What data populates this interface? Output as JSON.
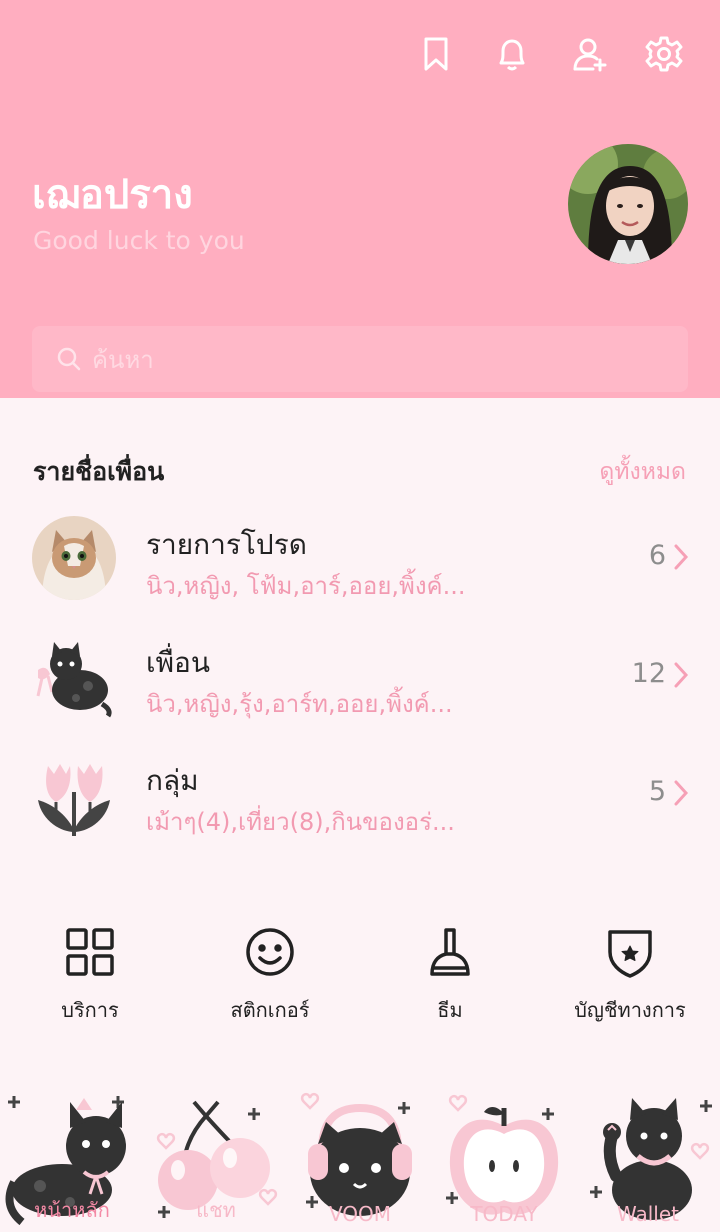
{
  "header": {
    "profile_name": "เฌอปราง",
    "status_message": "Good luck to you",
    "icons": [
      "bookmark-icon",
      "bell-icon",
      "add-friend-icon",
      "gear-icon"
    ]
  },
  "search": {
    "placeholder": "ค้นหา"
  },
  "friends_section": {
    "title": "รายชื่อเพื่อน",
    "see_all": "ดูทั้งหมด",
    "rows": [
      {
        "title": "รายการโปรด",
        "subtitle": "นิว,หญิง, โฟ้ม,อาร์,ออย,พิ้งค์...",
        "count": "6",
        "thumb": "cat-photo"
      },
      {
        "title": "เพื่อน",
        "subtitle": "นิว,หญิง,รุ้ง,อาร์ท,ออย,พิ้งค์...",
        "count": "12",
        "thumb": "black-cat-sticker"
      },
      {
        "title": "กลุ่ม",
        "subtitle": "เม้าๆ(4),เที่ยว(8),กินของอร่...",
        "count": "5",
        "thumb": "tulip-sticker"
      }
    ]
  },
  "features": [
    {
      "label": "บริการ",
      "icon": "grid-icon"
    },
    {
      "label": "สติกเกอร์",
      "icon": "smiley-icon"
    },
    {
      "label": "ธีม",
      "icon": "brush-icon"
    },
    {
      "label": "บัญชีทางการ",
      "icon": "shield-star-icon"
    }
  ],
  "tabbar": {
    "tabs": [
      {
        "label": "หน้าหลัก",
        "icon": "cat-home-icon",
        "active": true
      },
      {
        "label": "แชท",
        "icon": "cherry-icon",
        "active": false
      },
      {
        "label": "VOOM",
        "icon": "cat-headphones-icon",
        "active": false
      },
      {
        "label": "TODAY",
        "icon": "apple-icon",
        "active": false
      },
      {
        "label": "Wallet",
        "icon": "cat-waving-icon",
        "active": false
      }
    ]
  },
  "colors": {
    "header_bg": "#ffaec0",
    "accent": "#f48aa6",
    "page_bg": "#fdf3f6"
  }
}
